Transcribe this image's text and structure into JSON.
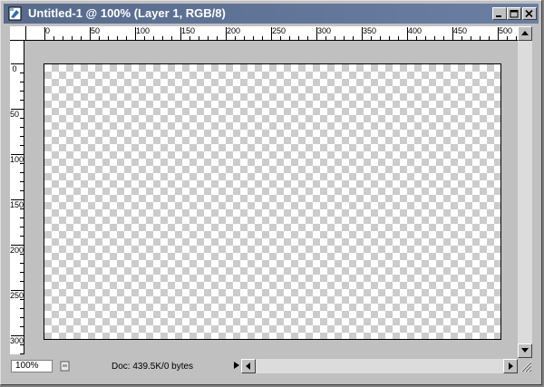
{
  "window": {
    "title": "Untitled-1 @ 100% (Layer 1, RGB/8)",
    "titlebar_color": "#5f7396",
    "buttons": [
      "minimize",
      "maximize",
      "close"
    ]
  },
  "rulers": {
    "horizontal_labels": [
      "0",
      "50",
      "100",
      "150",
      "200",
      "250",
      "300",
      "350",
      "400",
      "450",
      "500"
    ],
    "vertical_labels": [
      "0",
      "50",
      "100",
      "150",
      "200",
      "250",
      "300"
    ]
  },
  "canvas": {
    "background": "transparent-checkerboard",
    "checker_color": "#cccccc"
  },
  "status": {
    "zoom": "100%",
    "doc_info": "Doc: 439.5K/0 bytes"
  },
  "icons": {
    "app": "photoshop-document-icon",
    "status": "page-icon"
  }
}
